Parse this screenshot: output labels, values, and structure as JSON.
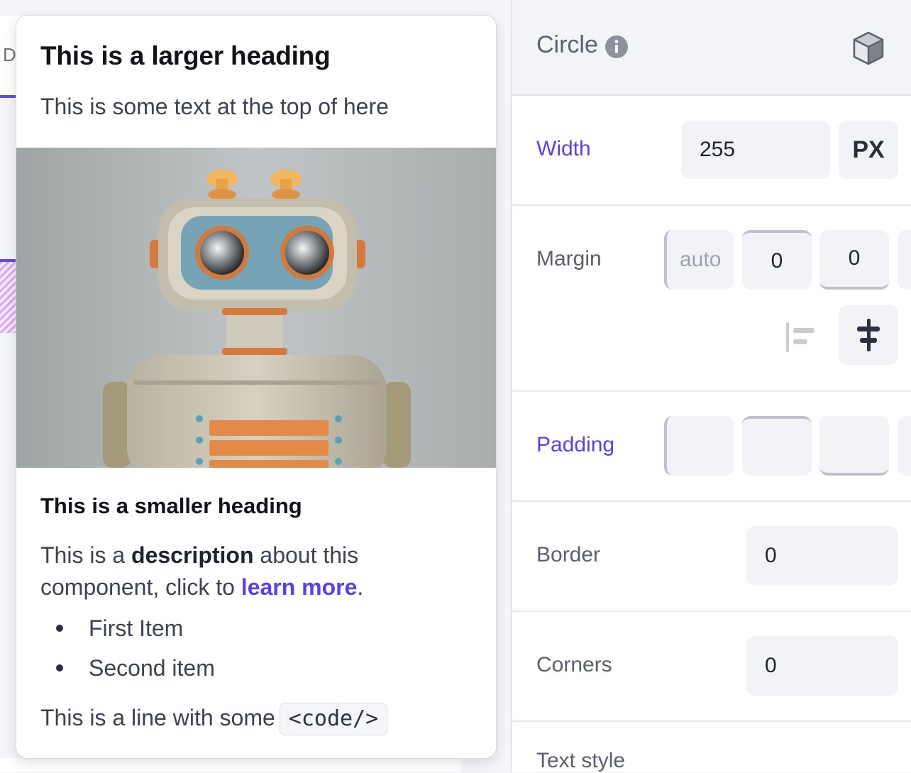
{
  "card": {
    "heading_large": "This is a larger heading",
    "top_text": "This is some text at the top of here",
    "heading_small": "This is a smaller heading",
    "desc_part1": "This is a ",
    "desc_bold": "description",
    "desc_part2": " about this component, click to ",
    "desc_link": "learn more",
    "desc_end": ".",
    "list_items": [
      "First Item",
      "Second item"
    ],
    "code_line_text": "This is a line with some",
    "code_snippet": "<code/>"
  },
  "canvas": {
    "tab_letter": "D"
  },
  "panel": {
    "title": "Circle",
    "rows": {
      "width": {
        "label": "Width",
        "value": "255",
        "unit": "PX"
      },
      "margin": {
        "label": "Margin",
        "left": "auto",
        "top": "0",
        "right": "0"
      },
      "padding": {
        "label": "Padding",
        "left": "",
        "top": "",
        "right": ""
      },
      "border": {
        "label": "Border",
        "value": "0"
      },
      "corners": {
        "label": "Corners",
        "value": "0"
      },
      "text_style": {
        "label": "Text style"
      }
    }
  },
  "colors": {
    "accent": "#5b3ff0",
    "panel_header_bg": "#f3f4f8",
    "field_bg": "#f2f3f7"
  },
  "icons": [
    "info-icon",
    "cube-icon",
    "align-left-icon",
    "align-center-icon"
  ]
}
